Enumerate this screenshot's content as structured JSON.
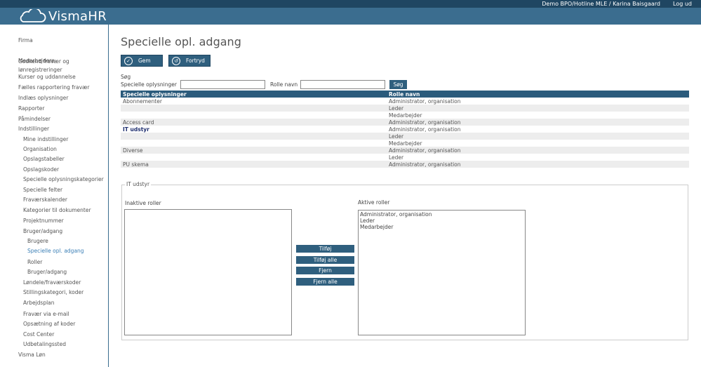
{
  "topbar": {
    "user": "Demo BPO/Hotline MLE / Karina Baisgaard",
    "logout": "Log ud"
  },
  "brand": {
    "name": "VismaHR"
  },
  "colors": {
    "topbar": "#1f4662",
    "header": "#3b6d8f",
    "accent": "#2f5f7e",
    "active_link": "#3b7fb6"
  },
  "sidebar": {
    "items": [
      {
        "label": "Firma",
        "level": 0
      },
      {
        "label": "Medarbejdere",
        "level": 0
      },
      {
        "label": "Godkend fravær og",
        "level": 0
      },
      {
        "label": "lønregistreringer",
        "level": 0
      },
      {
        "label": "Kurser og uddannelse",
        "level": 0
      },
      {
        "label": "Fælles rapportering fravær",
        "level": 0
      },
      {
        "label": "Indlæs oplysninger",
        "level": 0
      },
      {
        "label": "Rapporter",
        "level": 0
      },
      {
        "label": "Påmindelser",
        "level": 0
      },
      {
        "label": "Indstillinger",
        "level": 0
      },
      {
        "label": "Mine indstillinger",
        "level": 1
      },
      {
        "label": "Organisation",
        "level": 1
      },
      {
        "label": "Opslagstabeller",
        "level": 1
      },
      {
        "label": "Opslagskoder",
        "level": 1
      },
      {
        "label": "Specielle oplysningskategorier",
        "level": 1
      },
      {
        "label": "Specielle felter",
        "level": 1
      },
      {
        "label": "Fraværskalender",
        "level": 1
      },
      {
        "label": "Kategorier til dokumenter",
        "level": 1
      },
      {
        "label": "Projektnummer",
        "level": 1
      },
      {
        "label": "Bruger/adgang",
        "level": 1
      },
      {
        "label": "Brugere",
        "level": 2
      },
      {
        "label": "Specielle opl. adgang",
        "level": 2,
        "active": true
      },
      {
        "label": "Roller",
        "level": 2
      },
      {
        "label": "Bruger/adgang",
        "level": 2
      },
      {
        "label": "Løndele/fraværskoder",
        "level": 1
      },
      {
        "label": "Stillingskategori, koder",
        "level": 1
      },
      {
        "label": "Arbejdsplan",
        "level": 1
      },
      {
        "label": "Fravær via e-mail",
        "level": 1
      },
      {
        "label": "Opsætning af koder",
        "level": 1
      },
      {
        "label": "Cost Center",
        "level": 1
      },
      {
        "label": "Udbetalingssted",
        "level": 1
      },
      {
        "label": "Visma Løn",
        "level": 0
      }
    ]
  },
  "page": {
    "title": "Specielle opl. adgang"
  },
  "toolbar": {
    "save_label": "Gem",
    "undo_label": "Fortryd"
  },
  "search": {
    "label": "Søg",
    "special_label": "Specielle oplysninger",
    "role_label": "Rolle navn",
    "special_value": "",
    "role_value": "",
    "button_label": "Søg"
  },
  "table": {
    "headers": [
      "Specielle oplysninger",
      "Rolle navn"
    ],
    "rows": [
      {
        "info": "Abonnementer",
        "role": "Administrator, organisation",
        "alt": false,
        "bold": false
      },
      {
        "info": "",
        "role": "Leder",
        "alt": true,
        "bold": false
      },
      {
        "info": "",
        "role": "Medarbejder",
        "alt": false,
        "bold": false
      },
      {
        "info": "Access card",
        "role": "Administrator, organisation",
        "alt": true,
        "bold": false
      },
      {
        "info": "IT udstyr",
        "role": "Administrator, organisation",
        "alt": false,
        "bold": true
      },
      {
        "info": "",
        "role": "Leder",
        "alt": true,
        "bold": false
      },
      {
        "info": "",
        "role": "Medarbejder",
        "alt": false,
        "bold": false
      },
      {
        "info": "Diverse",
        "role": "Administrator, organisation",
        "alt": true,
        "bold": false
      },
      {
        "info": "",
        "role": "Leder",
        "alt": false,
        "bold": false
      },
      {
        "info": "PU skema",
        "role": "Administrator, organisation",
        "alt": true,
        "bold": false
      }
    ]
  },
  "panel": {
    "legend": "IT udstyr",
    "inactive_label": "Inaktive roller",
    "active_label": "Aktive roller",
    "inactive_roles": [],
    "active_roles": [
      "Administrator, organisation",
      "Leder",
      "Medarbejder"
    ],
    "add_label": "Tilføj",
    "add_all_label": "Tilføj alle",
    "remove_label": "Fjern",
    "remove_all_label": "Fjern alle"
  }
}
